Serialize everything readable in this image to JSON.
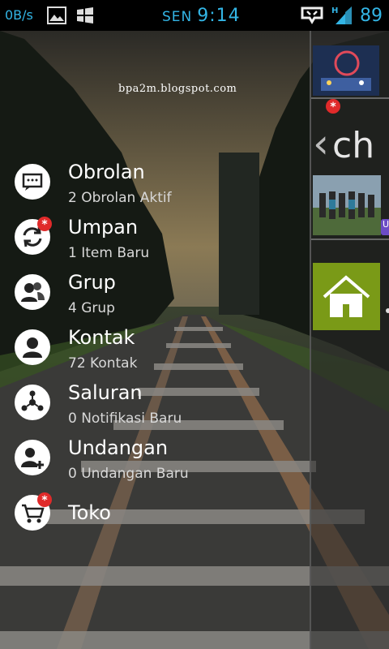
{
  "status_bar": {
    "net_speed": "0B/s",
    "day": "SEN",
    "time": "9:14",
    "battery": "89"
  },
  "watermark": "bpa2m.blogspot.com",
  "menu": {
    "items": [
      {
        "title": "Obrolan",
        "subtitle": "2 Obrolan Aktif",
        "icon": "chat-icon",
        "badge": false
      },
      {
        "title": "Umpan",
        "subtitle": "1 Item Baru",
        "icon": "refresh-icon",
        "badge": true
      },
      {
        "title": "Grup",
        "subtitle": "4 Grup",
        "icon": "group-icon",
        "badge": false
      },
      {
        "title": "Kontak",
        "subtitle": "72 Kontak",
        "icon": "contact-icon",
        "badge": false
      },
      {
        "title": "Saluran",
        "subtitle": "0 Notifikasi Baru",
        "icon": "channel-icon",
        "badge": false
      },
      {
        "title": "Undangan",
        "subtitle": "0 Undangan Baru",
        "icon": "invite-icon",
        "badge": false
      },
      {
        "title": "Toko",
        "subtitle": "",
        "icon": "cart-icon",
        "badge": true
      }
    ],
    "badge_symbol": "*"
  },
  "panel": {
    "header": "ch",
    "tab_letter": "U"
  },
  "colors": {
    "status_text": "#33b5e5",
    "badge": "#e02a2a",
    "home_tile": "#7a9a17"
  }
}
